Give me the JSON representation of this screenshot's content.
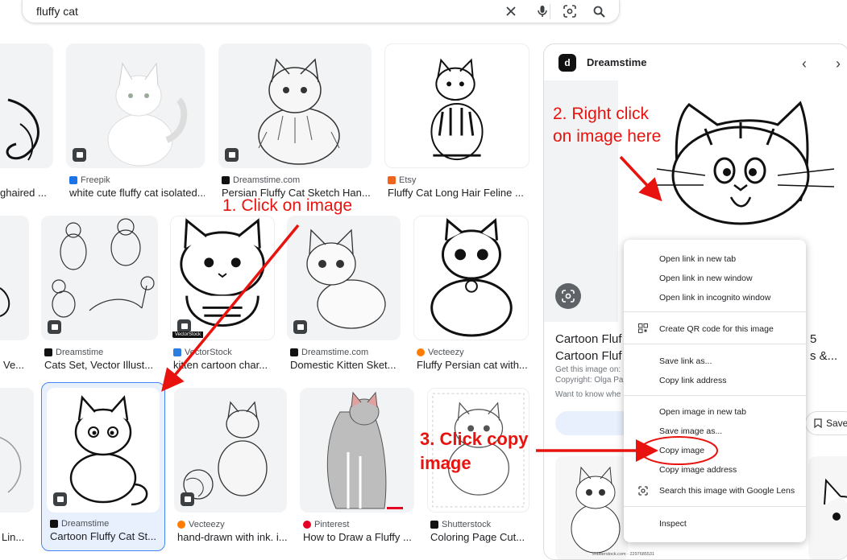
{
  "search": {
    "query": "fluffy cat"
  },
  "tiles": {
    "r1c0": {
      "caption": "ghaired ..."
    },
    "r1c1": {
      "source": "Freepik",
      "caption": "white cute fluffy cat isolated..."
    },
    "r1c2": {
      "source": "Dreamstime.com",
      "caption": "Persian Fluffy Cat Sketch Han..."
    },
    "r1c3": {
      "source": "Etsy",
      "caption": "Fluffy Cat Long Hair Feline ..."
    },
    "r2c0": {
      "caption": "Ve..."
    },
    "r2c1": {
      "source": "Dreamstime",
      "caption": "Cats Set, Vector Illust..."
    },
    "r2c2": {
      "source": "VectorStock",
      "caption": "kitten cartoon char..."
    },
    "r2c3": {
      "source": "Dreamstime.com",
      "caption": "Domestic Kitten Sket..."
    },
    "r2c4": {
      "source": "Vecteezy",
      "caption": "Fluffy Persian cat with..."
    },
    "r3c0": {
      "caption": "Lin..."
    },
    "r3c1": {
      "source": "Dreamstime",
      "caption": "Cartoon Fluffy Cat St..."
    },
    "r3c2": {
      "source": "Vecteezy",
      "caption": "hand-drawn with ink. i..."
    },
    "r3c3": {
      "source": "Pinterest",
      "caption": "How to Draw a Fluffy ..."
    },
    "r3c4": {
      "source": "Shutterstock",
      "caption": "Coloring Page Cut..."
    }
  },
  "watermarks": {
    "vectorstock": "VectorStock",
    "shutterstock": "shutterstock.com · 2297685531"
  },
  "panel": {
    "logo": "d",
    "site": "Dreamstime",
    "title_line1": "Cartoon Fluf",
    "title_line2": "Cartoon Fluf",
    "title_suffix1": "5",
    "title_suffix2": "s &...",
    "get_this": "Get this image on:",
    "copyright": "Copyright: Olga Pa",
    "want": "Want to know whe",
    "save": "Save"
  },
  "menu": {
    "items": [
      "Open link in new tab",
      "Open link in new window",
      "Open link in incognito window",
      "Create QR code for this image",
      "Save link as...",
      "Copy link address",
      "Open image in new tab",
      "Save image as...",
      "Copy image",
      "Copy image address",
      "Search this image with Google Lens",
      "Inspect"
    ]
  },
  "annotations": {
    "step1": "1. Click on image",
    "step2_line1": "2. Right click",
    "step2_line2": "on image here",
    "step3_line1": "3. Click copy",
    "step3_line2": "image"
  },
  "colors": {
    "annotation": "#e8130e",
    "selection": "#4285f4",
    "freepik": "#1a73e8",
    "etsy": "#f1641e",
    "pinterest": "#e60023",
    "vecteezy": "#ff7c00"
  }
}
